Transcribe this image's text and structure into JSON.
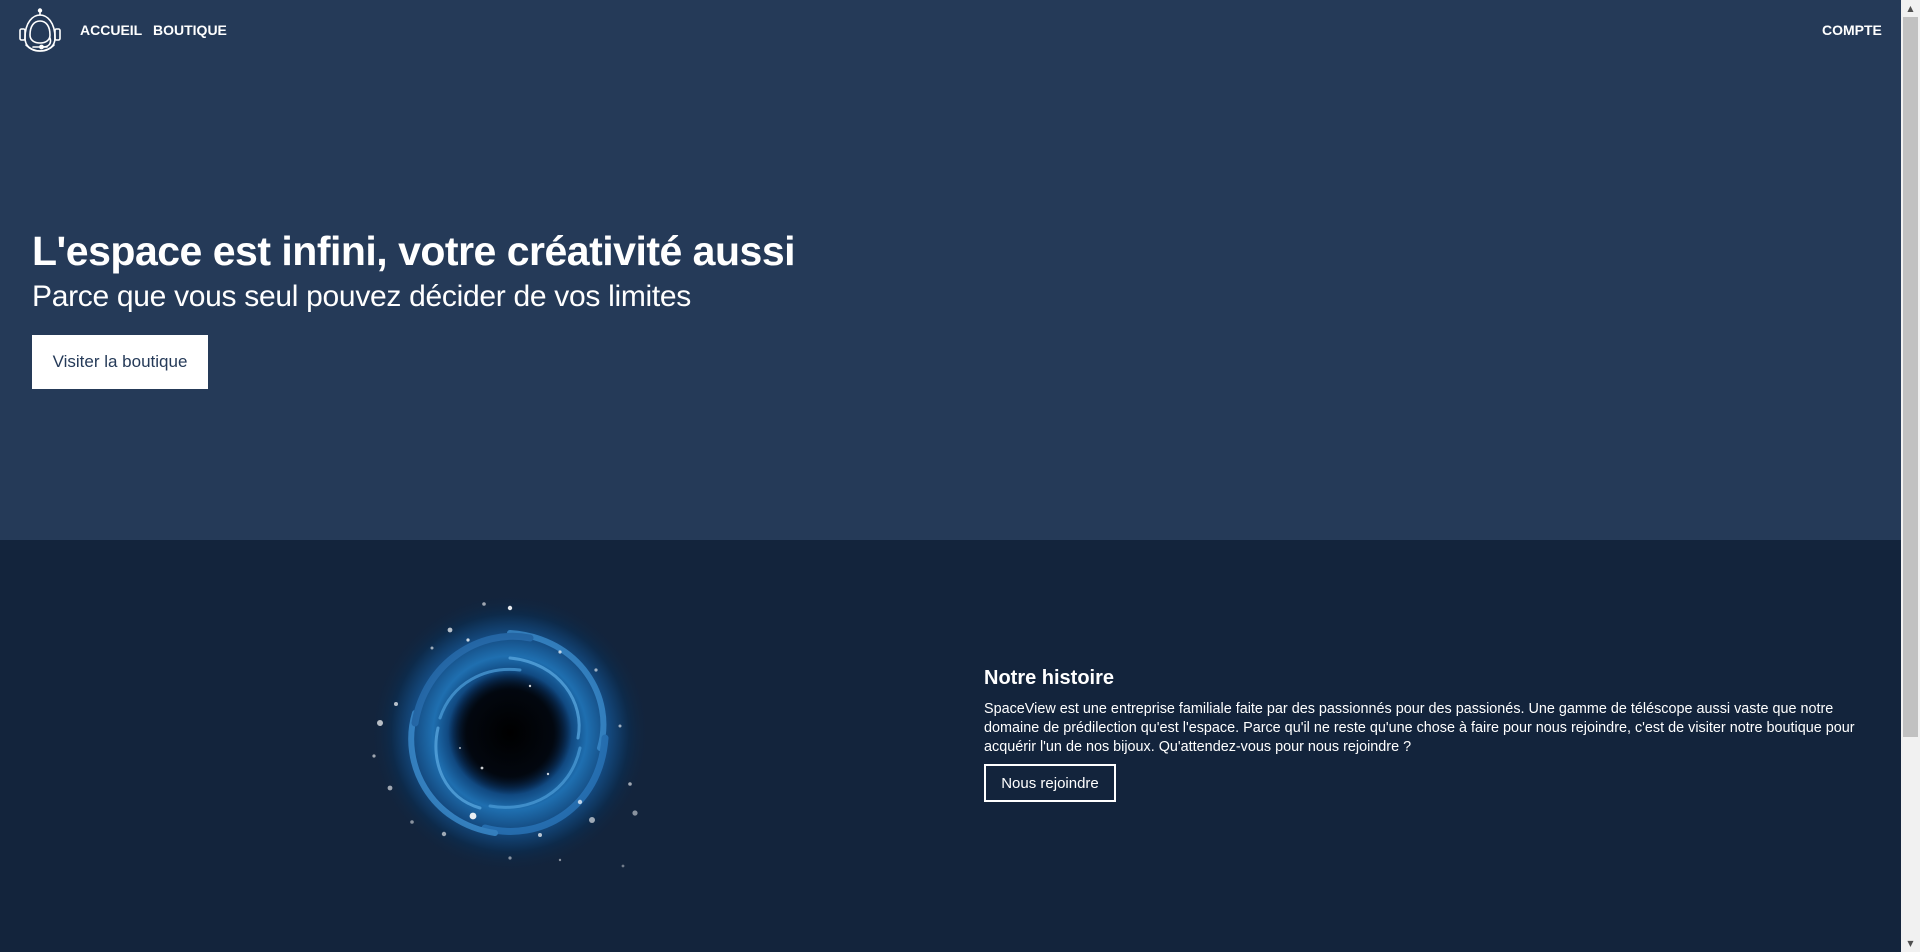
{
  "header": {
    "logo_icon": "astronaut-helmet-icon",
    "nav": {
      "home_label": "ACCUEIL",
      "shop_label": "BOUTIQUE",
      "account_label": "COMPTE"
    }
  },
  "hero": {
    "title": "L'espace est infini, votre créativité aussi",
    "subtitle": "Parce que vous seul pouvez décider de vos limites",
    "cta_label": "Visiter la boutique"
  },
  "story": {
    "image_icon": "black-hole-image",
    "title": "Notre histoire",
    "text": "SpaceView est une entreprise familiale faite par des passionnés pour des passionés. Une gamme de téléscope aussi vaste que notre domaine de prédilection qu'est l'espace. Parce qu'il ne reste qu'une chose à faire pour nous rejoindre, c'est de visiter notre boutique pour acquérir l'un de nos bijoux. Qu'attendez-vous pour nous rejoindre ?",
    "cta_label": "Nous rejoindre"
  },
  "colors": {
    "hero_background": "#253a58",
    "story_background": "#13243c",
    "text": "#ffffff",
    "button_background": "#ffffff"
  }
}
